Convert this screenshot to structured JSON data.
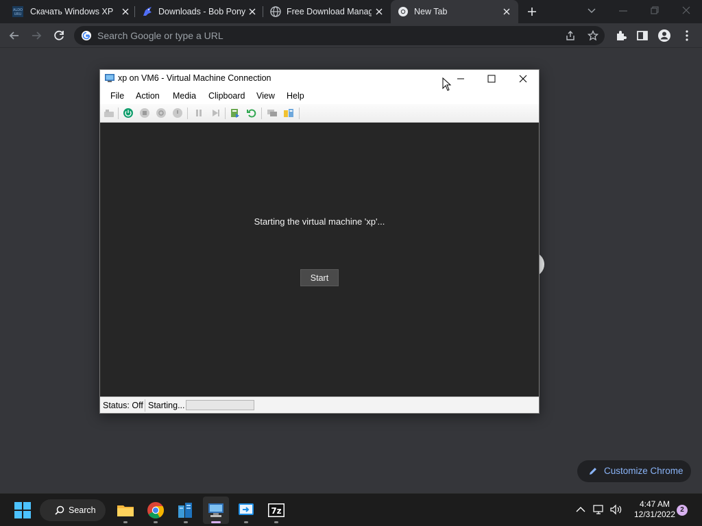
{
  "browser": {
    "tabs": [
      {
        "title": "Скачать Windows XP S",
        "favicon": "bobpony-favicon",
        "active": false
      },
      {
        "title": "Downloads - Bob Pony",
        "favicon": "bobpony-unicorn-icon",
        "active": false
      },
      {
        "title": "Free Download Manag",
        "favicon": "globe-icon",
        "active": false
      },
      {
        "title": "New Tab",
        "favicon": "chrome-icon",
        "active": true
      }
    ],
    "omnibox": {
      "placeholder": "Search Google or type a URL",
      "value": ""
    },
    "customize_label": "Customize Chrome"
  },
  "vm_window": {
    "title": "xp on VM6 - Virtual Machine Connection",
    "menu": [
      "File",
      "Action",
      "Media",
      "Clipboard",
      "View",
      "Help"
    ],
    "message": "Starting the virtual machine 'xp'...",
    "start_button": "Start",
    "status": {
      "state": "Status: Off",
      "activity": "Starting...",
      "progress": 0
    }
  },
  "taskbar": {
    "search_label": "Search",
    "time": "4:47 AM",
    "date": "12/31/2022",
    "notification_count": "2"
  },
  "colors": {
    "tab_strip": "#202124",
    "toolbar": "#35363a",
    "accent_link": "#8ab4f8",
    "vm_screen": "#262626",
    "taskbar": "#1c1c1c"
  }
}
